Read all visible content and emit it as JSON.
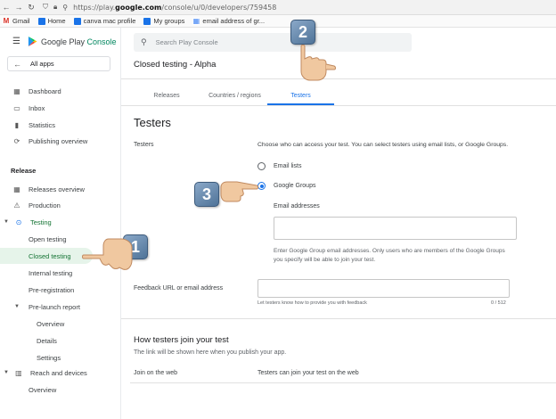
{
  "browser": {
    "url_prefix": "https://play.",
    "url_domain": "google.com",
    "url_path": "/console/u/0/developers/759458",
    "bookmarks": [
      {
        "label": "Gmail",
        "icon": "gmail-icon"
      },
      {
        "label": "Home",
        "icon": "folder-icon"
      },
      {
        "label": "canva mac profile",
        "icon": "folder-icon"
      },
      {
        "label": "My groups",
        "icon": "folder-icon"
      },
      {
        "label": "email address of gr...",
        "icon": "grid-icon"
      }
    ]
  },
  "sidebar": {
    "brand_prefix": "Google Play ",
    "brand_suffix": "Console",
    "all_apps": "All apps",
    "items_top": [
      {
        "label": "Dashboard",
        "icon": "dashboard-icon"
      },
      {
        "label": "Inbox",
        "icon": "inbox-icon"
      },
      {
        "label": "Statistics",
        "icon": "statistics-icon"
      },
      {
        "label": "Publishing overview",
        "icon": "publishing-icon"
      }
    ],
    "section_release": "Release",
    "release_items": [
      {
        "label": "Releases overview"
      },
      {
        "label": "Production"
      },
      {
        "label": "Testing"
      },
      {
        "label": "Open testing"
      },
      {
        "label": "Closed testing"
      },
      {
        "label": "Internal testing"
      },
      {
        "label": "Pre-registration"
      },
      {
        "label": "Pre-launch report"
      },
      {
        "label": "Overview"
      },
      {
        "label": "Details"
      },
      {
        "label": "Settings"
      },
      {
        "label": "Reach and devices"
      },
      {
        "label": "Overview"
      }
    ]
  },
  "header": {
    "search_placeholder": "Search Play Console",
    "page_title": "Closed testing - Alpha"
  },
  "tabs": [
    {
      "label": "Releases"
    },
    {
      "label": "Countries / regions"
    },
    {
      "label": "Testers",
      "active": true
    }
  ],
  "testers": {
    "heading": "Testers",
    "field_label": "Testers",
    "description": "Choose who can access your test. You can select testers using email lists, or Google Groups.",
    "option_email": "Email lists",
    "option_groups": "Google Groups",
    "selected": "Google Groups",
    "email_addresses_label": "Email addresses",
    "email_help_1": "Enter Google Group email addresses. Only users who are members of the Google Groups",
    "email_help_2": "you specify will be able to join your test.",
    "feedback_label": "Feedback URL or email address",
    "feedback_help": "Let testers know how to provide you with feedback",
    "feedback_count": "0 / 512"
  },
  "join": {
    "heading": "How testers join your test",
    "desc": "The link will be shown here when you publish your app.",
    "web_label": "Join on the web",
    "web_value": "Testers can join your test on the web"
  },
  "annotations": {
    "step1": "1",
    "step2": "2",
    "step3": "3"
  },
  "colors": {
    "accent": "#1a73e8",
    "active_nav_bg": "#e6f4ea",
    "active_nav_text": "#137333",
    "brand_green": "#01875f"
  }
}
